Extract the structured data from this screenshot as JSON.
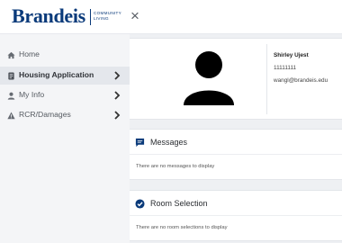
{
  "header": {
    "brand_name": "Brandeis",
    "brand_sub_line1": "COMMUNITY",
    "brand_sub_line2": "LIVING",
    "close_glyph": "×",
    "brand_color": "#0a3a7a"
  },
  "sidebar": {
    "items": [
      {
        "label": "Home",
        "icon": "home-icon",
        "active": false,
        "has_chevron": false
      },
      {
        "label": "Housing Application",
        "icon": "document-icon",
        "active": true,
        "has_chevron": true
      },
      {
        "label": "My Info",
        "icon": "person-icon",
        "active": false,
        "has_chevron": true
      },
      {
        "label": "RCR/Damages",
        "icon": "warning-icon",
        "active": false,
        "has_chevron": true
      }
    ]
  },
  "profile": {
    "name": "Shirley Ujest",
    "id_number": "11111111",
    "email": "wangl@brandeis.edu",
    "avatar_icon": "person-silhouette-icon"
  },
  "messages": {
    "title": "Messages",
    "icon": "chat-icon",
    "empty_text": "There are no messages to display"
  },
  "room_selection": {
    "title": "Room Selection",
    "icon": "check-circle-icon",
    "empty_text": "There are no room selections to display"
  },
  "colors": {
    "accent": "#0a3a7a",
    "sidebar_bg": "#f4f5f7",
    "main_bg": "#eef0f3"
  }
}
